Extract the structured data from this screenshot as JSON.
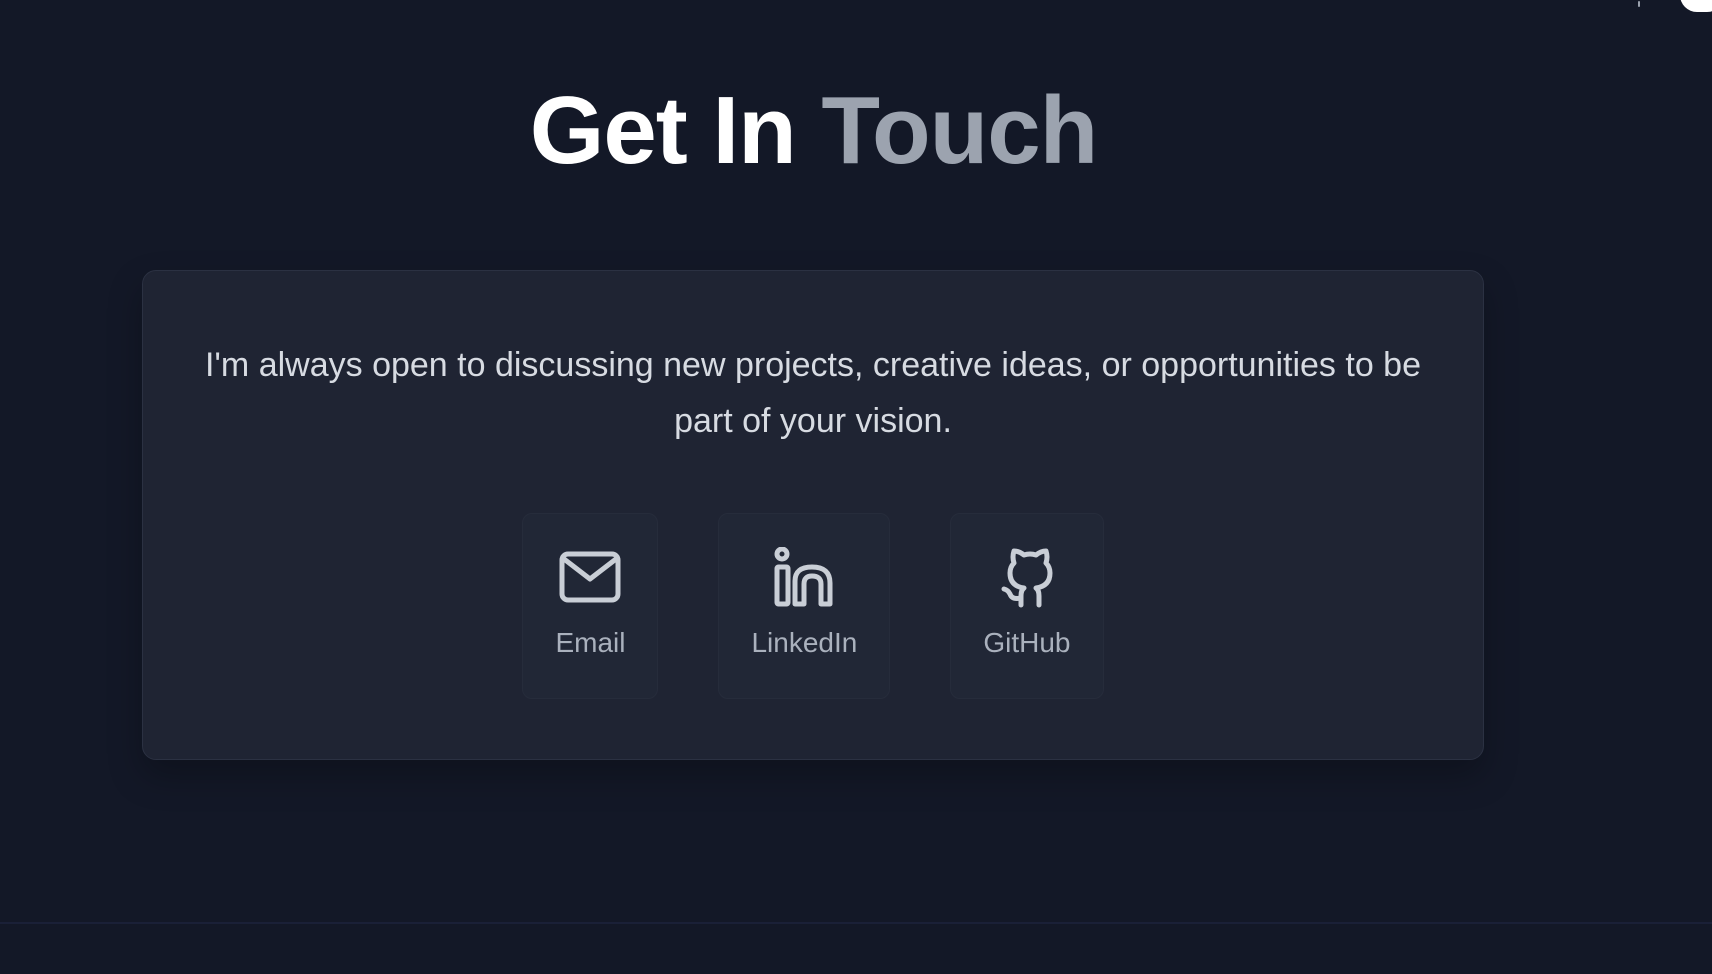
{
  "header": {
    "title_part1": "Get In ",
    "title_part2": "Touch"
  },
  "contact": {
    "description": "I'm always open to discussing new projects, creative ideas, or opportunities to be part of your vision."
  },
  "links": [
    {
      "label": "Email",
      "icon": "mail-icon"
    },
    {
      "label": "LinkedIn",
      "icon": "linkedin-icon"
    },
    {
      "label": "GitHub",
      "icon": "github-icon"
    }
  ],
  "colors": {
    "background": "#131827",
    "card": "#1f2433",
    "title_primary": "#ffffff",
    "title_secondary": "#9ca3af",
    "text": "#d7dbe2",
    "link_label": "#aab1bd"
  }
}
